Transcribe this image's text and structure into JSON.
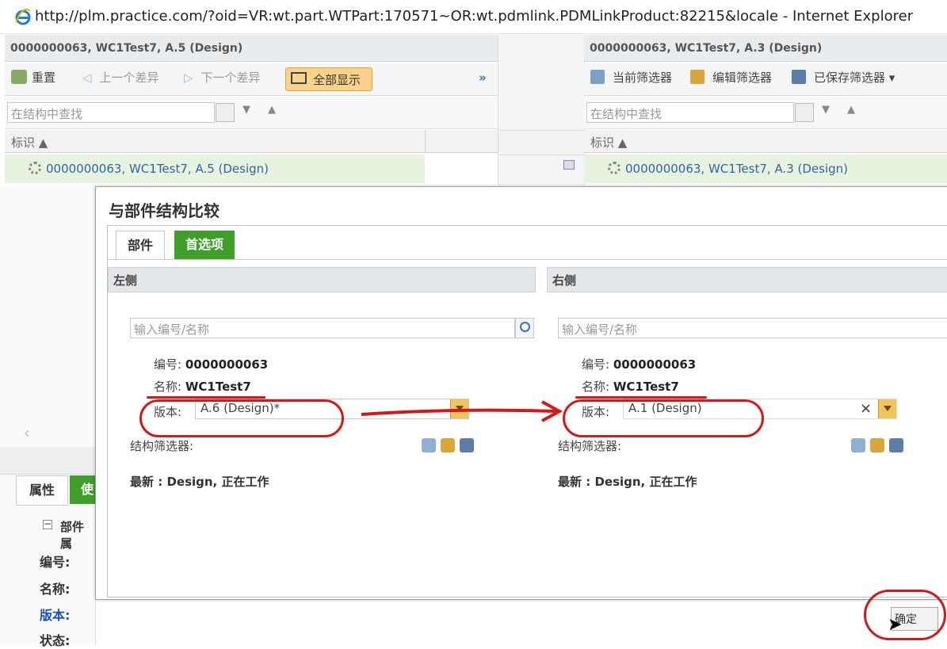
{
  "window": {
    "title": "http://plm.practice.com/?oid=VR:wt.part.WTPart:170571~OR:wt.pdmlink.PDMLinkProduct:82215&locale - Internet Explorer"
  },
  "left_panel": {
    "header": "0000000063, WC1Test7, A.5 (Design)",
    "toolbar": {
      "reset": "重置",
      "prev_diff": "上一个差异",
      "next_diff": "下一个差异",
      "show_all": "全部显示",
      "more": "»"
    },
    "search_placeholder": "在结构中查找",
    "col_header": "标识 ▲",
    "row": "0000000063, WC1Test7, A.5 (Design)"
  },
  "right_panel": {
    "header": "0000000063, WC1Test7, A.3 (Design)",
    "toolbar": {
      "current_filter": "当前筛选器",
      "edit_filter": "编辑筛选器",
      "saved_filter": "已保存筛选器 ▾"
    },
    "search_placeholder": "在结构中查找",
    "col_header": "标识 ▲",
    "row": "0000000063, WC1Test7, A.3 (Design)"
  },
  "bottom_panel": {
    "tabs": [
      "属性",
      "使"
    ],
    "section": "部件属",
    "labels": [
      "编号:",
      "名称:",
      "版本:",
      "状态:"
    ]
  },
  "dialog": {
    "title": "与部件结构比较",
    "tabs": [
      "部件",
      "首选项"
    ],
    "left": {
      "section": "左侧",
      "placeholder": "输入编号/名称",
      "number_label": "编号:",
      "number": "0000000063",
      "name_label": "名称:",
      "name": "WC1Test7",
      "version_label": "版本:",
      "version": "A.6 (Design)*",
      "filter_label": "结构筛选器:",
      "filter_value": "最新 : Design, 正在工作"
    },
    "right": {
      "section": "右侧",
      "placeholder": "输入编号/名称",
      "number_label": "编号:",
      "number": "0000000063",
      "name_label": "名称:",
      "name": "WC1Test7",
      "version_label": "版本:",
      "version": "A.1 (Design)",
      "clear": "×",
      "filter_label": "结构筛选器:",
      "filter_value": "最新 : Design, 正在工作"
    },
    "ok_button": "确定"
  },
  "colors": {
    "accent_green": "#3f9f2a",
    "annotation_red": "#d11a1a",
    "link_blue": "#2f64a8"
  }
}
